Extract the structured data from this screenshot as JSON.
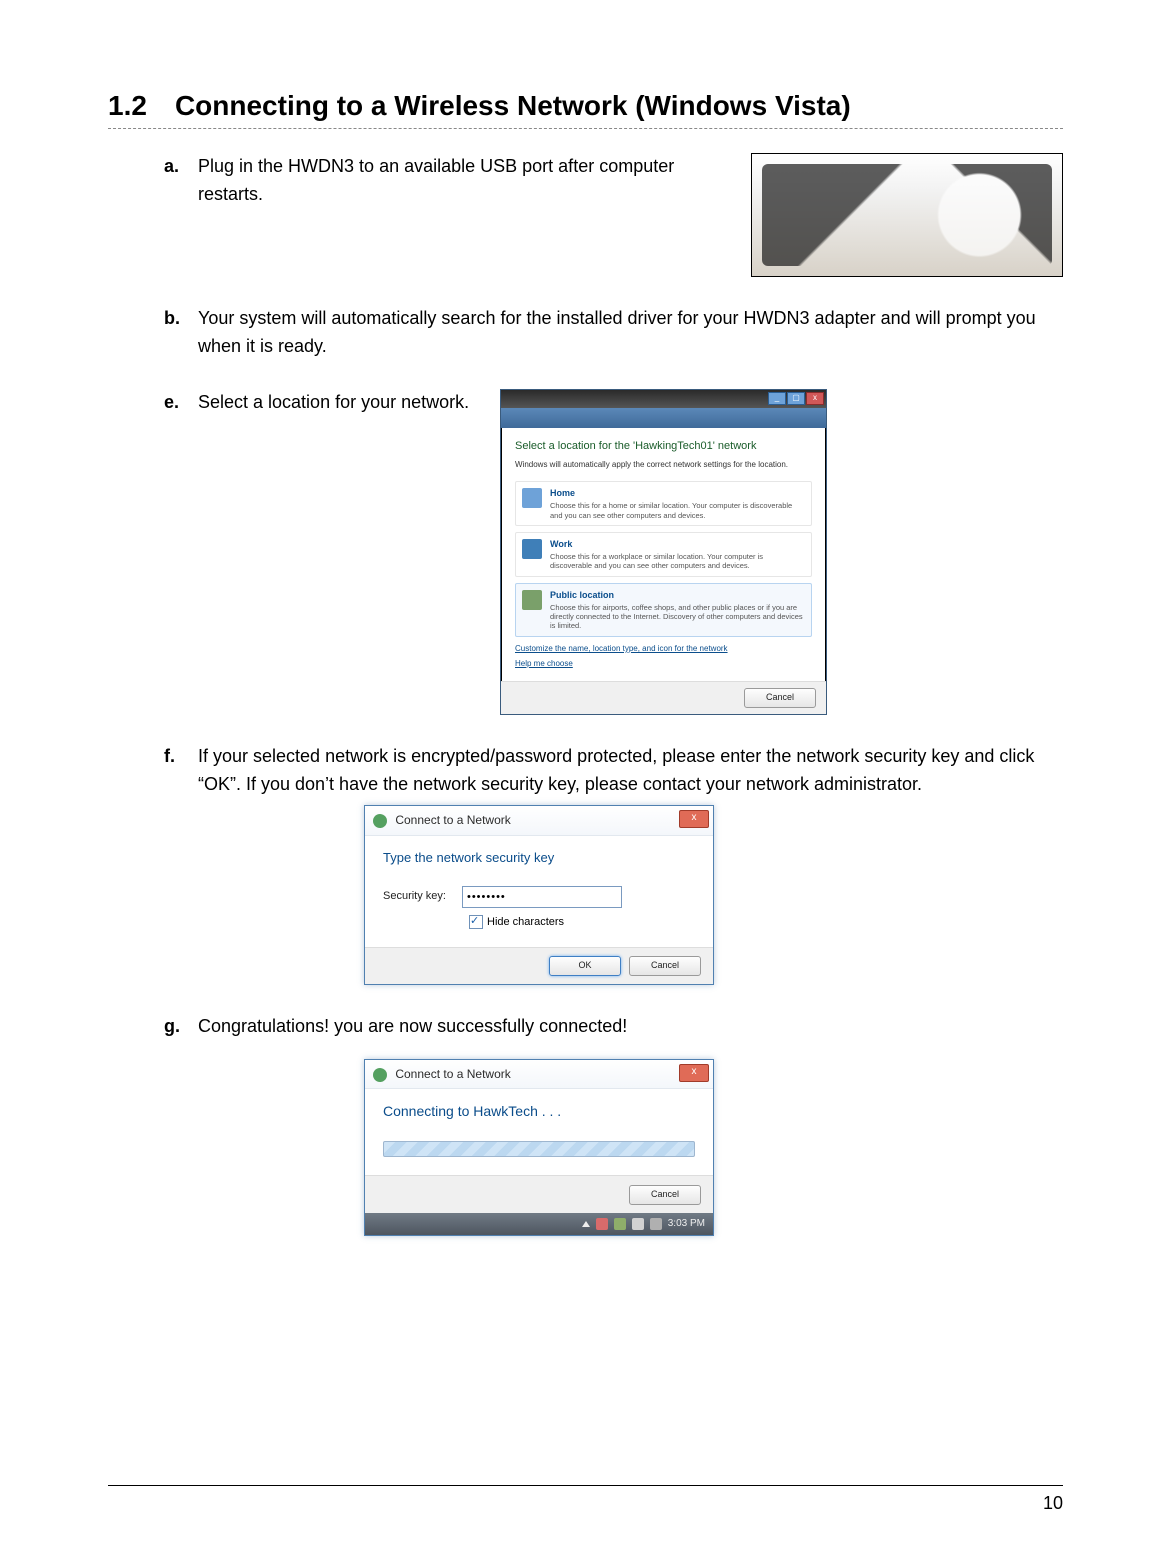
{
  "heading": {
    "number": "1.2",
    "text": "Connecting to a Wireless Network (Windows Vista)"
  },
  "steps": {
    "a": {
      "label": "a.",
      "text": "Plug in the HWDN3 to an available USB port after computer restarts."
    },
    "b": {
      "label": "b.",
      "text": "Your system will automatically search for the installed driver for your HWDN3 adapter and will prompt you when it is ready."
    },
    "e": {
      "label": "e.",
      "text": "Select a location for your network."
    },
    "f": {
      "label": "f.",
      "text": "If your selected network is encrypted/password protected, please enter the network security key and click “OK”. If you don’t have the network security key, please contact your network administrator."
    },
    "g": {
      "label": "g.",
      "text": "Congratulations! you are now successfully connected!"
    }
  },
  "vista_location": {
    "title": "Select a location for the 'HawkingTech01' network",
    "subtitle": "Windows will automatically apply the correct network settings for the location.",
    "options": [
      {
        "name": "Home",
        "desc": "Choose this for a home or similar location. Your computer is discoverable and you can see other computers and devices."
      },
      {
        "name": "Work",
        "desc": "Choose this for a workplace or similar location. Your computer is discoverable and you can see other computers and devices."
      },
      {
        "name": "Public location",
        "desc": "Choose this for airports, coffee shops, and other public places or if you are directly connected to the Internet. Discovery of other computers and devices is limited."
      }
    ],
    "link1": "Customize the name, location type, and icon for the network",
    "link2": "Help me choose",
    "cancel": "Cancel"
  },
  "security_dialog": {
    "window_title": "Connect to a Network",
    "heading": "Type the network security key",
    "field_label": "Security key:",
    "field_value": "••••••••",
    "hide_label": "Hide characters",
    "ok": "OK",
    "cancel": "Cancel"
  },
  "connecting_dialog": {
    "window_title": "Connect to a Network",
    "status": "Connecting to HawkTech . . .",
    "cancel": "Cancel",
    "tray_time": "3:03 PM"
  },
  "page_number": "10"
}
